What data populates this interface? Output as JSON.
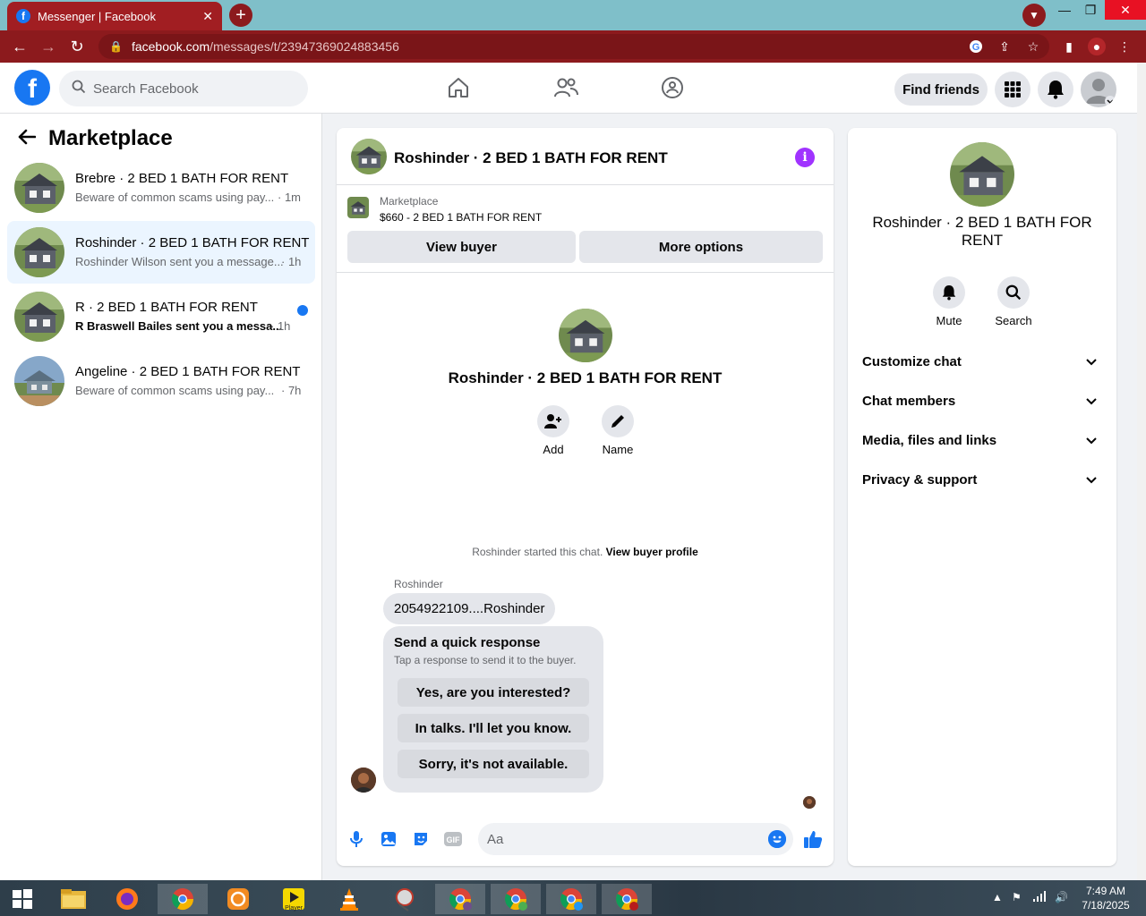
{
  "browser": {
    "tab_title": "Messenger | Facebook",
    "favicon_letter": "f",
    "url_host": "facebook.com",
    "url_path": "/messages/t/23947369024883456"
  },
  "header": {
    "logo_letter": "f",
    "search_placeholder": "Search Facebook",
    "find_friends": "Find friends"
  },
  "sidebar": {
    "title": "Marketplace",
    "conversations": [
      {
        "title": "Brebre · 2 BED 1 BATH FOR RENT",
        "snippet": "Beware of common scams using pay...",
        "time": "· 1m",
        "active": false,
        "unread": false
      },
      {
        "title": "Roshinder · 2 BED 1 BATH FOR RENT",
        "snippet": "Roshinder Wilson sent you a message...",
        "time": "· 1h",
        "active": true,
        "unread": false
      },
      {
        "title": "R · 2 BED 1 BATH FOR RENT",
        "snippet": "R Braswell Bailes sent you a messa...",
        "time": "· 1h",
        "active": false,
        "unread": true
      },
      {
        "title": "Angeline · 2 BED 1 BATH FOR RENT",
        "snippet": "Beware of common scams using pay...",
        "time": "· 7h",
        "active": false,
        "unread": false
      }
    ]
  },
  "chat": {
    "title": "Roshinder · 2 BED 1 BATH FOR RENT",
    "listing_label": "Marketplace",
    "listing_price": "$660 - 2 BED 1 BATH FOR RENT",
    "view_buyer": "View buyer",
    "more_options": "More options",
    "intro_title": "Roshinder · 2 BED 1 BATH FOR RENT",
    "add_label": "Add",
    "name_label": "Name",
    "started_text": "Roshinder started this chat.",
    "view_buyer_profile": "View buyer profile",
    "sender_name": "Roshinder",
    "message": "2054922109....Roshinder",
    "quick_title": "Send a quick response",
    "quick_sub": "Tap a response to send it to the buyer.",
    "quick_replies": [
      "Yes, are you interested?",
      "In talks. I'll let you know.",
      "Sorry, it's not available."
    ],
    "input_placeholder": "Aa",
    "gif_label": "GIF"
  },
  "details": {
    "title": "Roshinder · 2 BED 1 BATH FOR RENT",
    "mute": "Mute",
    "search": "Search",
    "rows": [
      "Customize chat",
      "Chat members",
      "Media, files and links",
      "Privacy & support"
    ]
  },
  "taskbar": {
    "time": "7:49 AM",
    "date": "7/18/2025",
    "player_label": "Player"
  },
  "colors": {
    "brand": "#1877f2",
    "chrome_frame": "#8c1a1d",
    "active_row": "#ebf5ff",
    "info": "#a033ff"
  }
}
